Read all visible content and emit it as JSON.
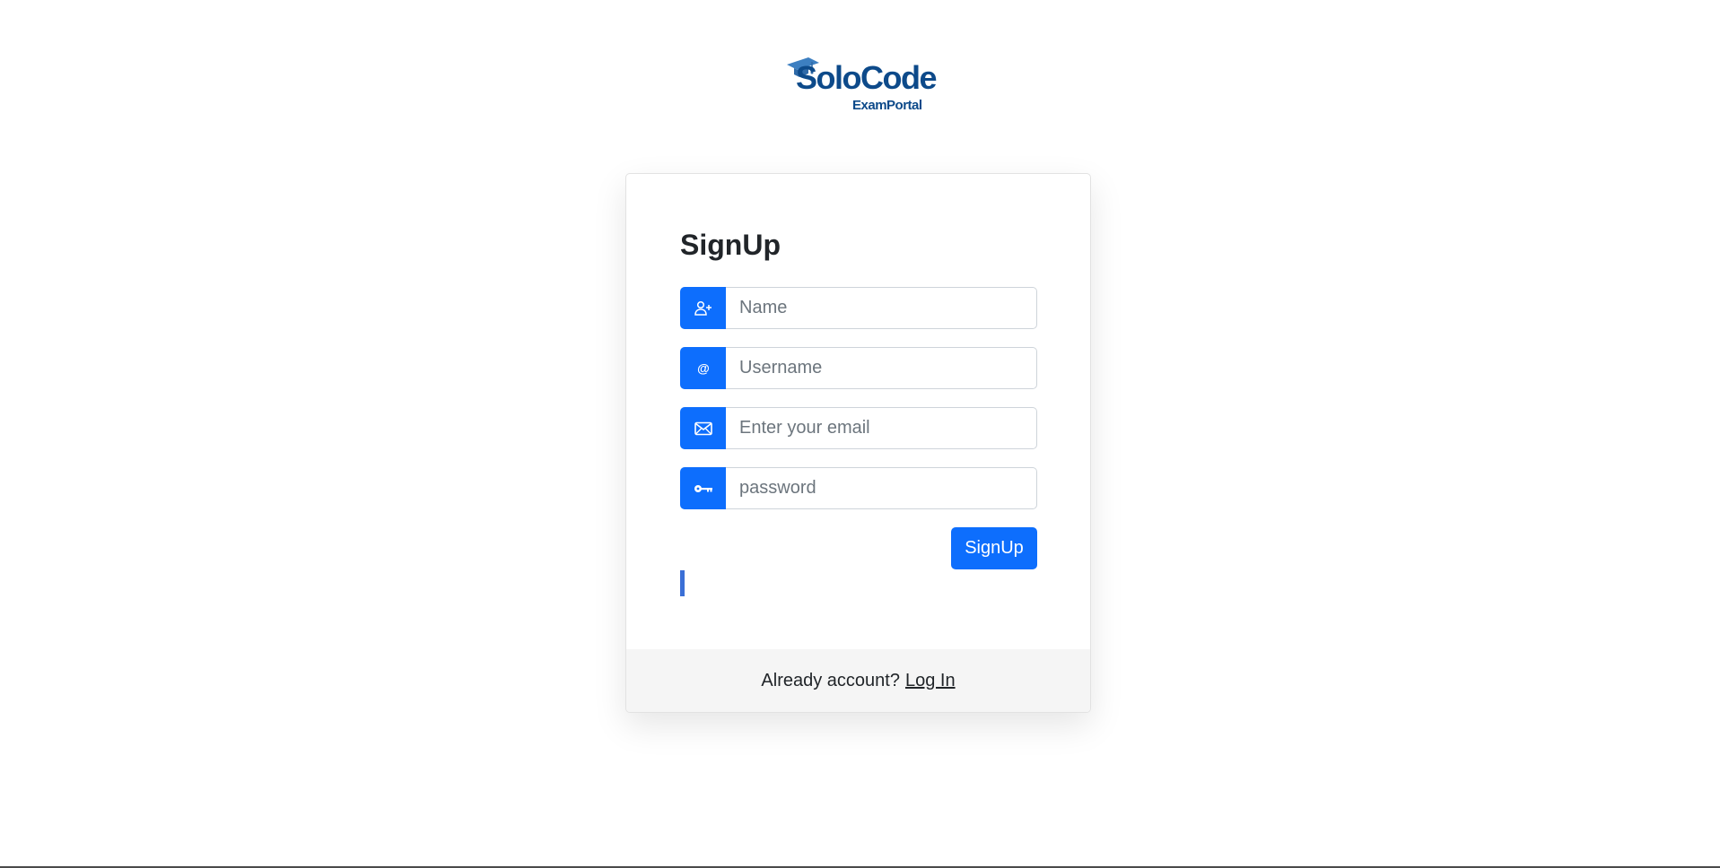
{
  "logo": {
    "title": "SoloCode",
    "subtitle": "ExamPortal",
    "brand_color": "#0d4a8a",
    "cap_color": "#3d7fc1"
  },
  "form": {
    "title": "SignUp",
    "fields": [
      {
        "name": "name",
        "icon": "person-plus-icon",
        "placeholder": "Name",
        "value": ""
      },
      {
        "name": "username",
        "icon": "at-icon",
        "placeholder": "Username",
        "value": ""
      },
      {
        "name": "email",
        "icon": "envelope-icon",
        "placeholder": "Enter your email",
        "value": ""
      },
      {
        "name": "password",
        "icon": "key-icon",
        "placeholder": "password",
        "value": ""
      }
    ],
    "submit_label": "SignUp",
    "accent_color": "#0d6efd"
  },
  "footer": {
    "text": "Already account?",
    "link_label": "Log In"
  }
}
